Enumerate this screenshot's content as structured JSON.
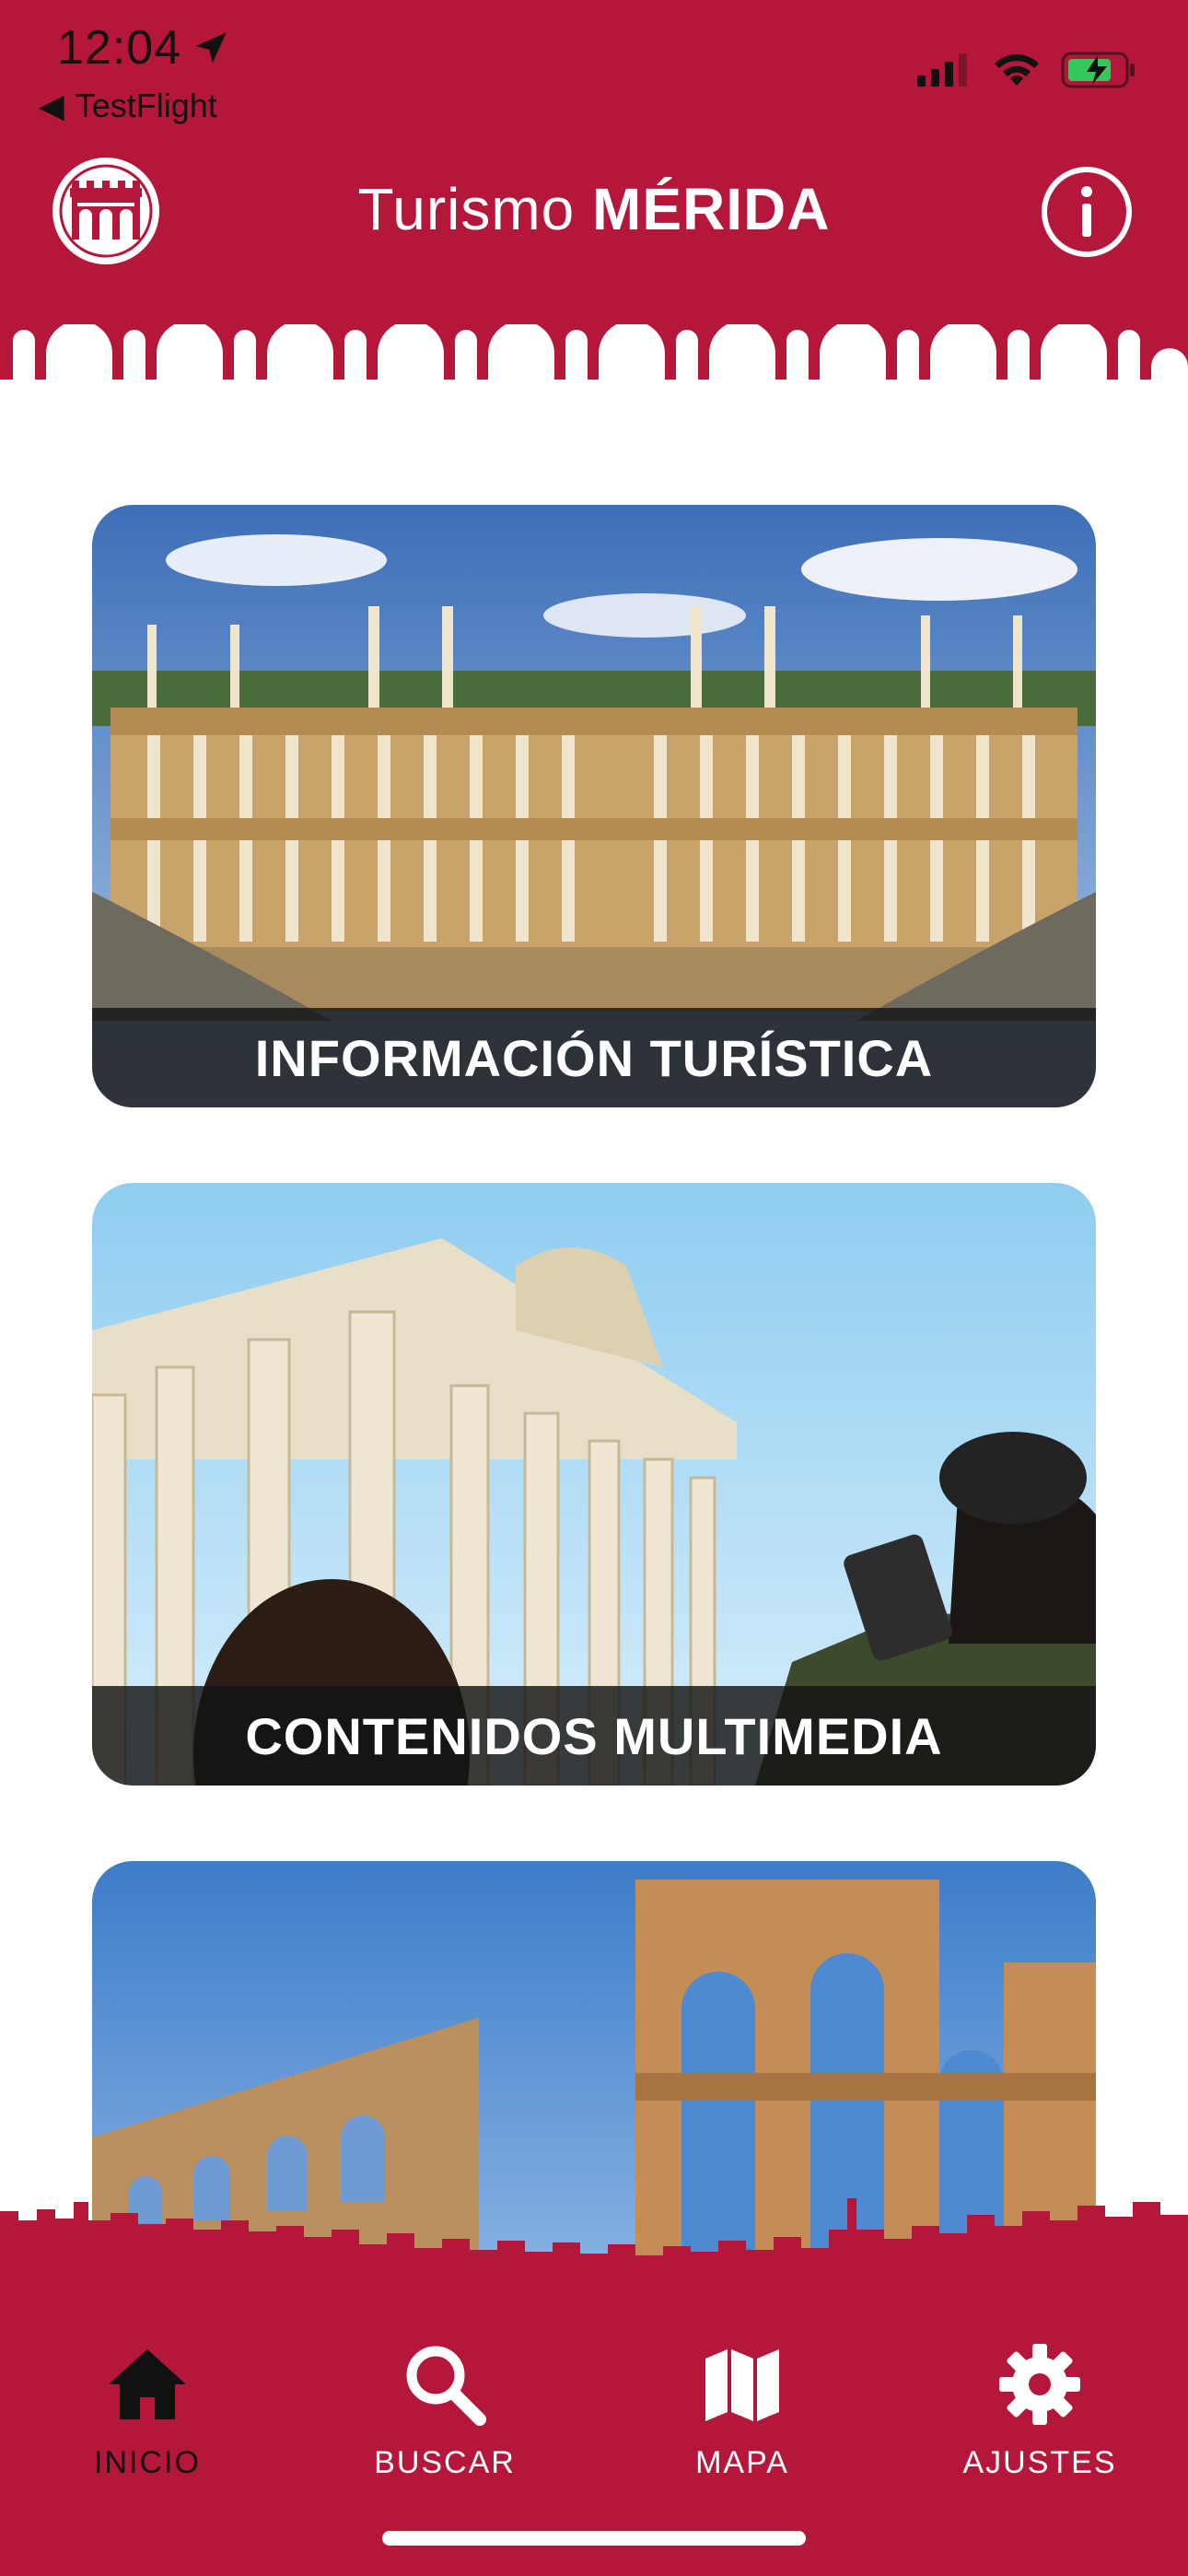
{
  "status_bar": {
    "time": "12:04",
    "back_app": "TestFlight"
  },
  "header": {
    "title_regular": "Turismo",
    "title_bold": "MÉRIDA"
  },
  "cards": [
    {
      "label": "INFORMACIÓN TURÍSTICA"
    },
    {
      "label": "CONTENIDOS MULTIMEDIA"
    },
    {
      "label": ""
    }
  ],
  "tabs": [
    {
      "label": "INICIO",
      "icon": "home-icon",
      "active": true
    },
    {
      "label": "BUSCAR",
      "icon": "search-icon",
      "active": false
    },
    {
      "label": "MAPA",
      "icon": "map-icon",
      "active": false
    },
    {
      "label": "AJUSTES",
      "icon": "gear-icon",
      "active": false
    }
  ],
  "colors": {
    "brand": "#b5173b",
    "active_tab": "#111111",
    "inactive_tab": "#ffffff"
  }
}
